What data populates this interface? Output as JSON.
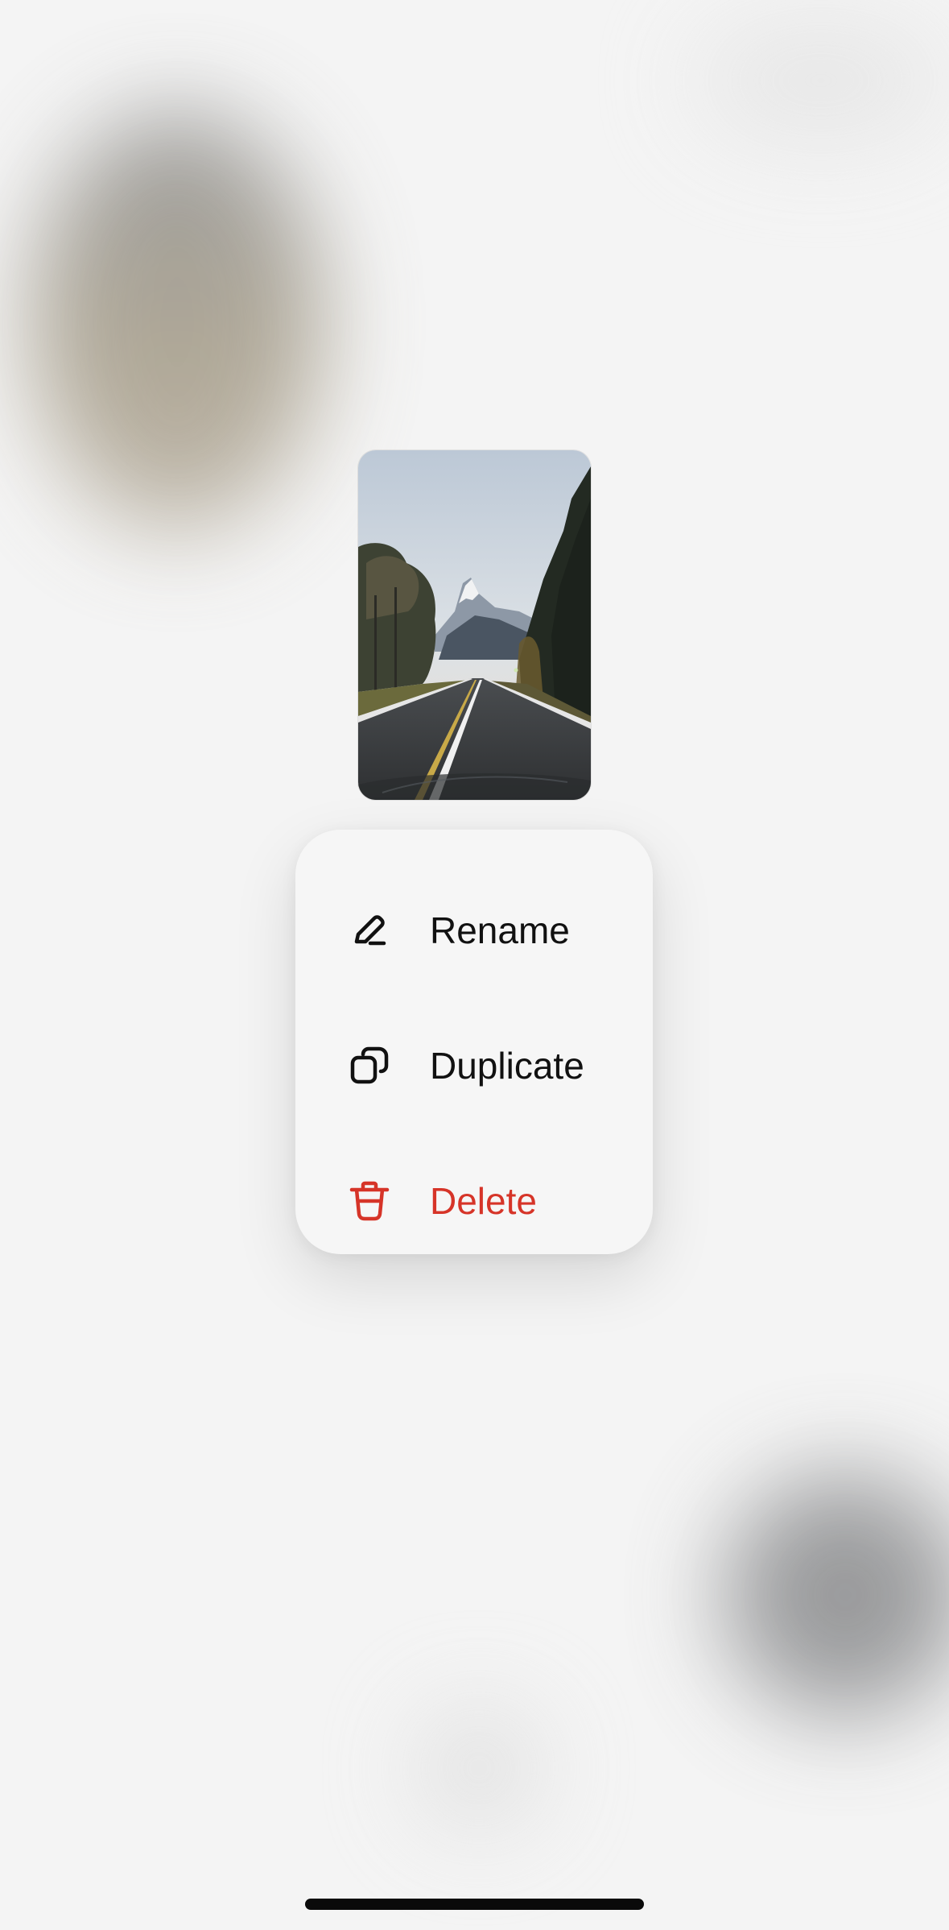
{
  "menu": {
    "items": [
      {
        "label": "Rename",
        "icon": "pencil-icon",
        "destructive": false
      },
      {
        "label": "Duplicate",
        "icon": "duplicate-icon",
        "destructive": false
      },
      {
        "label": "Delete",
        "icon": "trash-icon",
        "destructive": true
      }
    ]
  },
  "colors": {
    "background": "#f4f4f4",
    "menu_background": "#f6f6f6",
    "text": "#111111",
    "destructive": "#d63428",
    "home_indicator": "#0a0a0a"
  },
  "thumbnail": {
    "icon": "mountain-road-photo"
  }
}
